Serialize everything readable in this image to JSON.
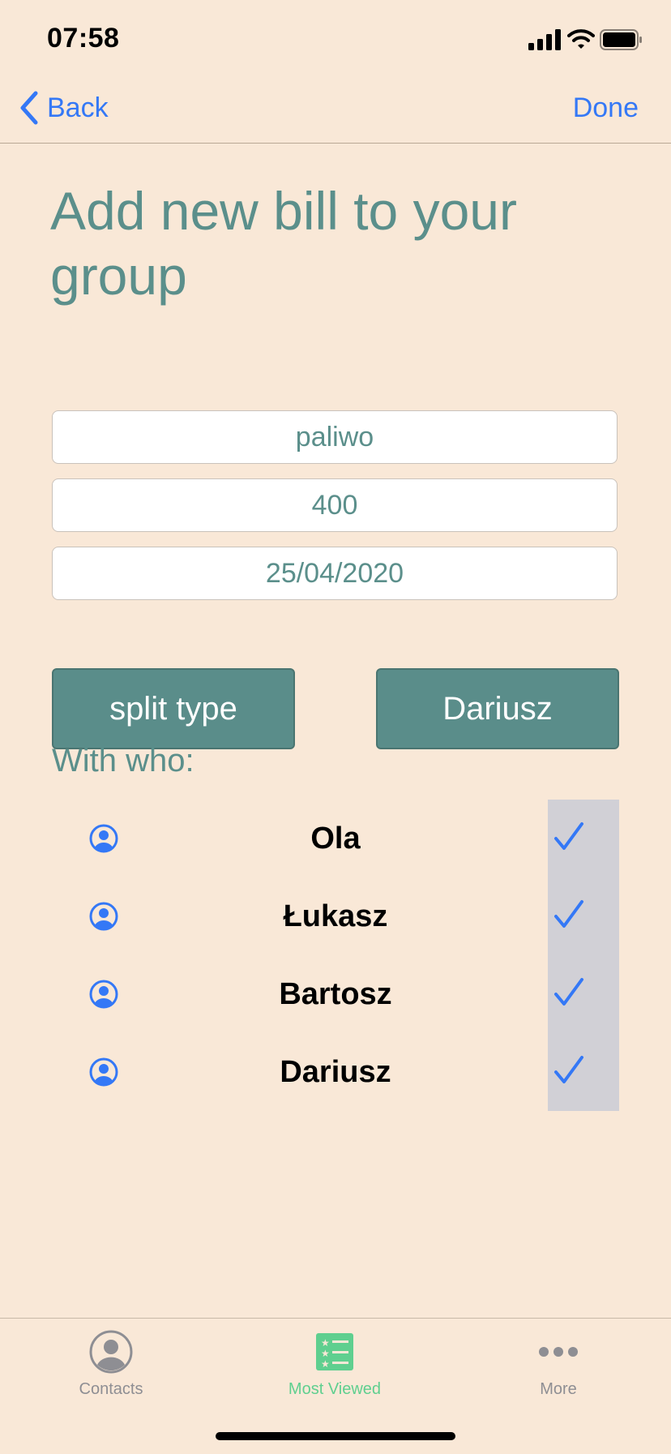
{
  "status_bar": {
    "time": "07:58"
  },
  "nav": {
    "back_label": "Back",
    "done_label": "Done"
  },
  "title": "Add new bill to your group",
  "form": {
    "name_value": "paliwo",
    "amount_value": "400",
    "date_value": "25/04/2020"
  },
  "buttons": {
    "split_type": "split type",
    "payer": "Dariusz"
  },
  "with_who_label": "With who:",
  "people": [
    {
      "name": "Ola",
      "checked": true
    },
    {
      "name": "Łukasz",
      "checked": true
    },
    {
      "name": "Bartosz",
      "checked": true
    },
    {
      "name": "Dariusz",
      "checked": true
    }
  ],
  "tabs": [
    {
      "label": "Contacts",
      "icon": "person-circle-icon",
      "active": false
    },
    {
      "label": "Most Viewed",
      "icon": "list-stars-icon",
      "active": true
    },
    {
      "label": "More",
      "icon": "more-dots-icon",
      "active": false
    }
  ],
  "colors": {
    "background": "#f9e8d7",
    "accent_blue": "#3478f6",
    "teal_text": "#5b8f8b",
    "button_teal": "#5a8d8a",
    "tab_active": "#5fcf8f",
    "tab_inactive": "#8e8e93"
  }
}
